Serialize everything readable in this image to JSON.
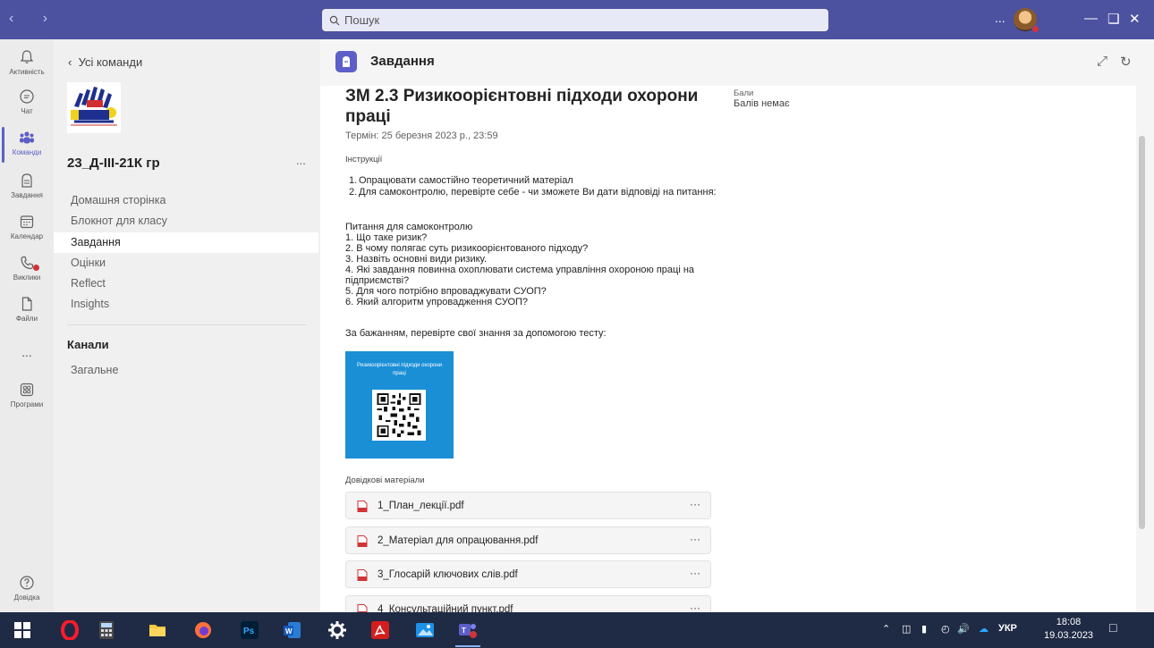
{
  "titlebar": {
    "search_placeholder": "Пошук",
    "more": "...",
    "accent": "#4c51a0"
  },
  "rail": {
    "items": [
      {
        "label": "Активність",
        "icon": "bell-icon"
      },
      {
        "label": "Чат",
        "icon": "chat-icon"
      },
      {
        "label": "Команди",
        "icon": "teams-icon"
      },
      {
        "label": "Завдання",
        "icon": "assignments-icon"
      },
      {
        "label": "Календар",
        "icon": "calendar-icon"
      },
      {
        "label": "Виклики",
        "icon": "phone-icon"
      },
      {
        "label": "Файли",
        "icon": "file-icon"
      },
      {
        "label": "...",
        "icon": "more-icon"
      },
      {
        "label": "Програми",
        "icon": "apps-icon"
      },
      {
        "label": "Довідка",
        "icon": "help-icon"
      }
    ]
  },
  "team": {
    "back_label": "Усі команди",
    "logo_text": "КПК КУРСИ З ОХОРОНИ ПРАЦІ",
    "name": "23_Д-ІІІ-21К гр",
    "more": "...",
    "nav": [
      "Домашня сторінка",
      "Блокнот для класу",
      "Завдання",
      "Оцінки",
      "Reflect",
      "Insights"
    ],
    "active_nav": "Завдання",
    "channels_heading": "Канали",
    "channels": [
      "Загальне"
    ]
  },
  "main": {
    "title": "Завдання"
  },
  "assignment": {
    "title": "ЗМ 2.3 Ризикоорієнтовні підходи охорони праці",
    "due": "Термін: 25 березня 2023 р., 23:59",
    "points_label": "Бали",
    "points_value": "Балів немає",
    "instructions_label": "Інструкції",
    "steps": [
      "Опрацювати самостійно теоретичний матеріал",
      "Для самоконтролю, перевірте себе - чи зможете Ви дати відповіді на питання:"
    ],
    "questions_heading": "Питання для самоконтролю",
    "questions": [
      "1. Що таке ризик?",
      "2. В чому полягає суть ризикоорієнтованого підходу?",
      "3. Назвіть основні види ризику.",
      "4. Які завдання повинна охоплювати система управління охороною праці на підприємстві?",
      "5. Для чого потрібно впроваджувати СУОП?",
      "6. Який алгоритм упровадження СУОП?"
    ],
    "test_line": "За бажанням, перевірте свої знання за допомогою тесту:",
    "test_card_title": "Ризикоорієнтовні підходи охорони праці",
    "reference_label": "Довідкові матеріали",
    "references": [
      "1_План_лекції.pdf",
      "2_Матеріал для опрацювання.pdf",
      "3_Глосарій ключових слів.pdf",
      "4_Консультаційний пункт.pdf"
    ],
    "ref_more": "···"
  },
  "taskbar": {
    "language": "УКР",
    "time": "18:08",
    "date": "19.03.2023"
  }
}
